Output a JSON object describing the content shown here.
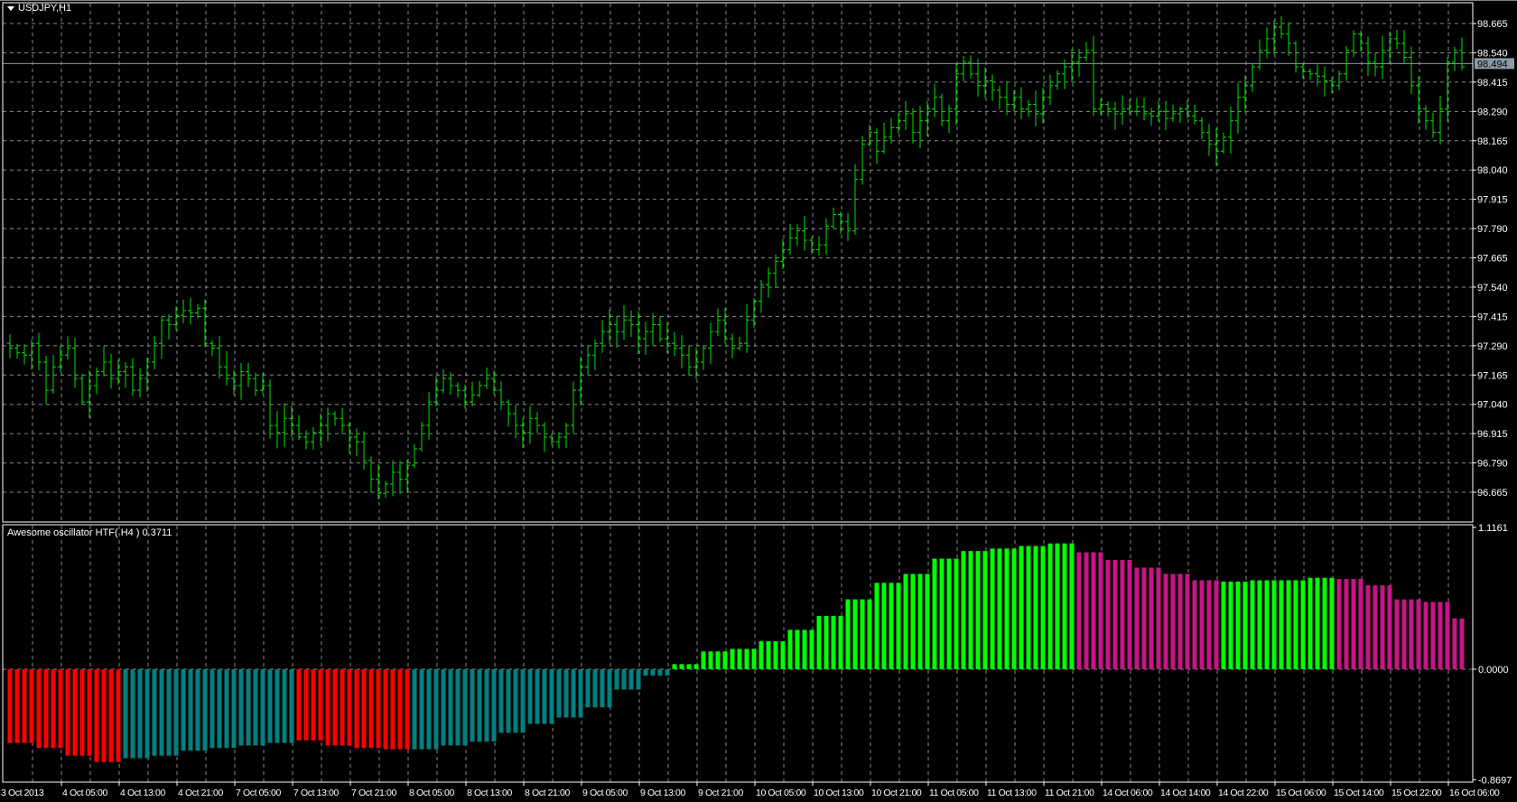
{
  "chart": {
    "symbol": "USDJPY,H1",
    "price_axis": [
      "98.665",
      "98.540",
      "98.415",
      "98.290",
      "98.165",
      "98.040",
      "97.915",
      "97.790",
      "97.665",
      "97.540",
      "97.415",
      "97.290",
      "97.165",
      "97.040",
      "96.915",
      "96.790",
      "96.665"
    ],
    "current_price": "98.494",
    "time_axis": [
      "3 Oct 2013",
      "4 Oct 05:00",
      "4 Oct 13:00",
      "4 Oct 21:00",
      "7 Oct 05:00",
      "7 Oct 13:00",
      "7 Oct 21:00",
      "8 Oct 05:00",
      "8 Oct 13:00",
      "8 Oct 21:00",
      "9 Oct 05:00",
      "9 Oct 13:00",
      "9 Oct 21:00",
      "10 Oct 05:00",
      "10 Oct 13:00",
      "10 Oct 21:00",
      "11 Oct 05:00",
      "11 Oct 13:00",
      "11 Oct 21:00",
      "14 Oct 06:00",
      "14 Oct 14:00",
      "14 Oct 22:00",
      "15 Oct 06:00",
      "15 Oct 14:00",
      "15 Oct 22:00",
      "16 Oct 06:00"
    ],
    "bar_color": "#00e000",
    "closes": [
      97.28,
      97.26,
      97.25,
      97.3,
      97.22,
      97.1,
      97.2,
      97.25,
      97.28,
      97.15,
      97.05,
      97.12,
      97.18,
      97.22,
      97.15,
      97.18,
      97.2,
      97.1,
      97.15,
      97.22,
      97.3,
      97.4,
      97.38,
      97.42,
      97.44,
      97.43,
      97.45,
      97.3,
      97.28,
      97.2,
      97.15,
      97.12,
      97.18,
      97.15,
      97.1,
      97.12,
      96.95,
      96.92,
      96.98,
      96.95,
      96.9,
      96.88,
      96.92,
      96.95,
      97.0,
      96.98,
      96.95,
      96.9,
      96.88,
      96.8,
      96.72,
      96.66,
      96.7,
      96.75,
      96.72,
      96.78,
      96.85,
      96.95,
      97.05,
      97.1,
      97.15,
      97.12,
      97.1,
      97.05,
      97.08,
      97.12,
      97.15,
      97.1,
      97.05,
      97.0,
      96.95,
      96.92,
      96.98,
      96.95,
      96.9,
      96.88,
      96.9,
      96.95,
      97.1,
      97.2,
      97.25,
      97.3,
      97.35,
      97.38,
      97.35,
      97.4,
      97.38,
      97.32,
      97.35,
      97.38,
      97.32,
      97.3,
      97.28,
      97.25,
      97.2,
      97.22,
      97.28,
      97.35,
      97.4,
      97.32,
      97.28,
      97.3,
      97.4,
      97.48,
      97.55,
      97.6,
      97.65,
      97.7,
      97.75,
      97.78,
      97.74,
      97.7,
      97.72,
      97.8,
      97.85,
      97.82,
      97.78,
      98.0,
      98.15,
      98.2,
      98.12,
      98.18,
      98.22,
      98.25,
      98.28,
      98.2,
      98.25,
      98.3,
      98.35,
      98.25,
      98.3,
      98.45,
      98.5,
      98.45,
      98.4,
      98.42,
      98.38,
      98.35,
      98.32,
      98.35,
      98.3,
      98.32,
      98.28,
      98.35,
      98.4,
      98.45,
      98.48,
      98.5,
      98.52,
      98.55,
      98.3,
      98.32,
      98.3,
      98.28,
      98.3,
      98.29,
      98.31,
      98.28,
      98.27,
      98.29,
      98.26,
      98.28,
      98.3,
      98.27,
      98.25,
      98.2,
      98.15,
      98.12,
      98.18,
      98.25,
      98.35,
      98.4,
      98.48,
      98.55,
      98.6,
      98.65,
      98.62,
      98.58,
      98.48,
      98.46,
      98.45,
      98.44,
      98.42,
      98.4,
      98.45,
      98.55,
      98.62,
      98.58,
      98.5,
      98.48,
      98.55,
      98.6,
      98.58,
      98.52,
      98.4,
      98.3,
      98.25,
      98.2,
      98.3,
      98.5,
      98.55,
      98.48
    ]
  },
  "indicator": {
    "title": "Awesome oscillator HTF( H4 ) 0.3711",
    "axis": [
      "1.1161",
      "0.0000",
      "-0.8697"
    ],
    "colors": [
      "#ff0000",
      "#008080",
      "#00ff00",
      "#c71585"
    ],
    "groups": [
      [
        -0.58,
        0
      ],
      [
        -0.62,
        0
      ],
      [
        -0.68,
        0
      ],
      [
        -0.73,
        0
      ],
      [
        -0.7,
        1
      ],
      [
        -0.68,
        1
      ],
      [
        -0.64,
        1
      ],
      [
        -0.62,
        1
      ],
      [
        -0.6,
        1
      ],
      [
        -0.58,
        1
      ],
      [
        -0.56,
        0
      ],
      [
        -0.6,
        0
      ],
      [
        -0.62,
        0
      ],
      [
        -0.63,
        0
      ],
      [
        -0.63,
        1
      ],
      [
        -0.6,
        1
      ],
      [
        -0.57,
        1
      ],
      [
        -0.5,
        1
      ],
      [
        -0.43,
        1
      ],
      [
        -0.38,
        1
      ],
      [
        -0.3,
        1
      ],
      [
        -0.16,
        1
      ],
      [
        -0.05,
        1
      ],
      [
        0.04,
        2
      ],
      [
        0.14,
        2
      ],
      [
        0.16,
        2
      ],
      [
        0.22,
        2
      ],
      [
        0.31,
        2
      ],
      [
        0.42,
        2
      ],
      [
        0.55,
        2
      ],
      [
        0.68,
        2
      ],
      [
        0.75,
        2
      ],
      [
        0.87,
        2
      ],
      [
        0.93,
        2
      ],
      [
        0.95,
        2
      ],
      [
        0.97,
        2
      ],
      [
        0.99,
        2
      ],
      [
        0.92,
        3
      ],
      [
        0.86,
        3
      ],
      [
        0.8,
        3
      ],
      [
        0.75,
        3
      ],
      [
        0.7,
        3
      ],
      [
        0.69,
        2
      ],
      [
        0.7,
        2
      ],
      [
        0.7,
        2
      ],
      [
        0.72,
        2
      ],
      [
        0.71,
        3
      ],
      [
        0.66,
        3
      ],
      [
        0.55,
        3
      ],
      [
        0.53,
        3
      ],
      [
        0.4,
        3
      ]
    ]
  }
}
